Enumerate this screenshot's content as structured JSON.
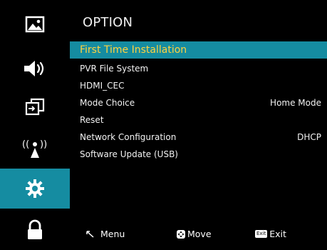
{
  "header": {
    "title": "OPTION"
  },
  "sidebar": {
    "items": [
      {
        "icon": "picture-icon",
        "active": false
      },
      {
        "icon": "sound-icon",
        "active": false
      },
      {
        "icon": "source-icon",
        "active": false
      },
      {
        "icon": "network-icon",
        "active": false
      },
      {
        "icon": "gear-icon",
        "active": true
      },
      {
        "icon": "lock-icon",
        "active": false
      }
    ]
  },
  "menu": {
    "items": [
      {
        "label": "First Time Installation",
        "value": "",
        "selected": true
      },
      {
        "label": "PVR File System",
        "value": ""
      },
      {
        "label": "HDMI_CEC",
        "value": ""
      },
      {
        "label": "Mode Choice",
        "value": "Home Mode"
      },
      {
        "label": "Reset",
        "value": ""
      },
      {
        "label": "Network Configuration",
        "value": "DHCP"
      },
      {
        "label": "Software Update (USB)",
        "value": ""
      }
    ]
  },
  "footer": {
    "menu_label": "Menu",
    "move_label": "Move",
    "exit_key": "Exit",
    "exit_label": "Exit"
  },
  "colors": {
    "accent": "#158ca1",
    "selected_text": "#ffd23f"
  }
}
